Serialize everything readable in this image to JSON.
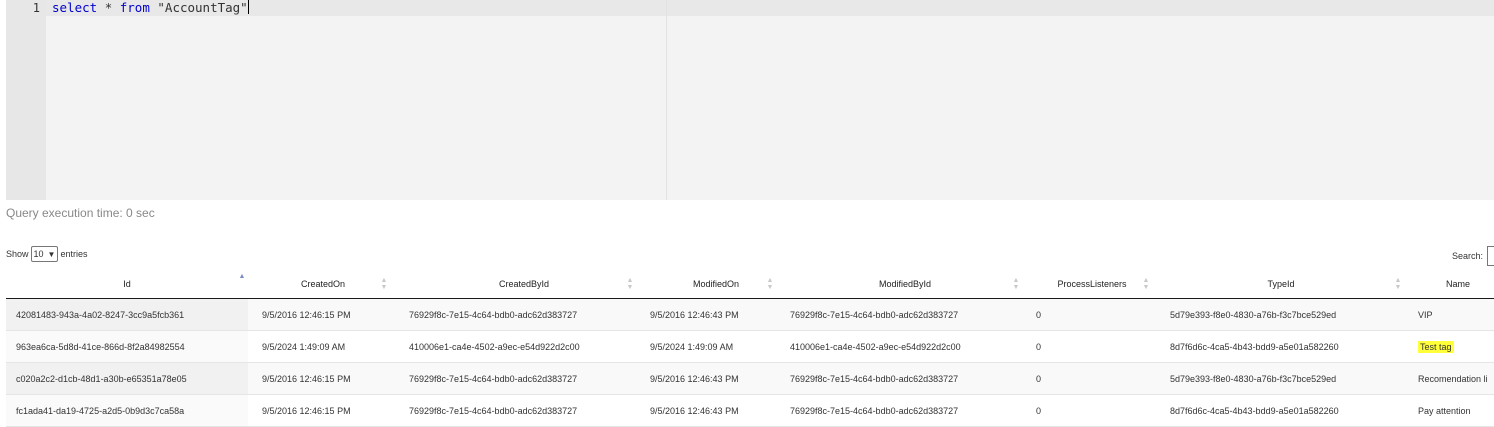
{
  "editor": {
    "line_number": "1",
    "query": {
      "kw_select": "select",
      "star": "*",
      "kw_from": "from",
      "table": "\"AccountTag\""
    }
  },
  "execution_time": "Query execution time: 0 sec",
  "controls": {
    "show_label": "Show",
    "length_value": "10",
    "entries_label": "entries",
    "search_label": "Search:"
  },
  "columns": [
    "Id",
    "CreatedOn",
    "CreatedById",
    "ModifiedOn",
    "ModifiedById",
    "ProcessListeners",
    "TypeId",
    "Name"
  ],
  "rows": [
    [
      "42081483-943a-4a02-8247-3cc9a5fcb361",
      "9/5/2016 12:46:15 PM",
      "76929f8c-7e15-4c64-bdb0-adc62d383727",
      "9/5/2016 12:46:43 PM",
      "76929f8c-7e15-4c64-bdb0-adc62d383727",
      "0",
      "5d79e393-f8e0-4830-a76b-f3c7bce529ed",
      "VIP"
    ],
    [
      "963ea6ca-5d8d-41ce-866d-8f2a84982554",
      "9/5/2024 1:49:09 AM",
      "410006e1-ca4e-4502-a9ec-e54d922d2c00",
      "9/5/2024 1:49:09 AM",
      "410006e1-ca4e-4502-a9ec-e54d922d2c00",
      "0",
      "8d7f6d6c-4ca5-4b43-bdd9-a5e01a582260",
      "Test tag"
    ],
    [
      "c020a2c2-d1cb-48d1-a30b-e65351a78e05",
      "9/5/2016 12:46:15 PM",
      "76929f8c-7e15-4c64-bdb0-adc62d383727",
      "9/5/2016 12:46:43 PM",
      "76929f8c-7e15-4c64-bdb0-adc62d383727",
      "0",
      "5d79e393-f8e0-4830-a76b-f3c7bce529ed",
      "Recomendation li"
    ],
    [
      "fc1ada41-da19-4725-a2d5-0b9d3c7ca58a",
      "9/5/2016 12:46:15 PM",
      "76929f8c-7e15-4c64-bdb0-adc62d383727",
      "9/5/2016 12:46:43 PM",
      "76929f8c-7e15-4c64-bdb0-adc62d383727",
      "0",
      "8d7f6d6c-4ca5-4b43-bdd9-a5e01a582260",
      "Pay attention"
    ]
  ],
  "highlight_color": "#ffff3a",
  "keyword_color": "#0000cd",
  "sorted_column": "Id",
  "sort_direction": "ascending"
}
